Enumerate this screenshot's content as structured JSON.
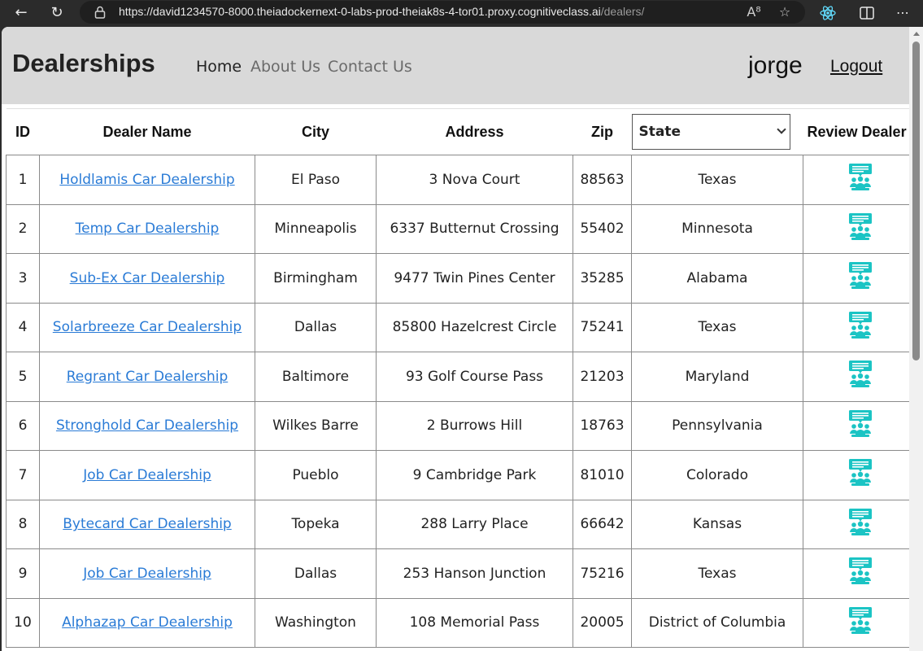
{
  "browser": {
    "url_host": "https://david1234570-8000.theiadockernext-0-labs-prod-theiak8s-4-tor01.proxy.cognitiveclass.ai",
    "url_path": "/dealers/"
  },
  "header": {
    "brand": "Dealerships",
    "nav": [
      {
        "label": "Home",
        "active": true
      },
      {
        "label": "About Us",
        "active": false
      },
      {
        "label": "Contact Us",
        "active": false
      }
    ],
    "username": "jorge",
    "logout": "Logout"
  },
  "table": {
    "columns": {
      "id": "ID",
      "name": "Dealer Name",
      "city": "City",
      "address": "Address",
      "zip": "Zip",
      "review": "Review Dealer"
    },
    "state_filter": {
      "selected": "State"
    },
    "rows": [
      {
        "id": "1",
        "name": "Holdlamis Car Dealership",
        "city": "El Paso",
        "address": "3 Nova Court",
        "zip": "88563",
        "state": "Texas"
      },
      {
        "id": "2",
        "name": "Temp Car Dealership",
        "city": "Minneapolis",
        "address": "6337 Butternut Crossing",
        "zip": "55402",
        "state": "Minnesota"
      },
      {
        "id": "3",
        "name": "Sub-Ex Car Dealership",
        "city": "Birmingham",
        "address": "9477 Twin Pines Center",
        "zip": "35285",
        "state": "Alabama"
      },
      {
        "id": "4",
        "name": "Solarbreeze Car Dealership",
        "city": "Dallas",
        "address": "85800 Hazelcrest Circle",
        "zip": "75241",
        "state": "Texas"
      },
      {
        "id": "5",
        "name": "Regrant Car Dealership",
        "city": "Baltimore",
        "address": "93 Golf Course Pass",
        "zip": "21203",
        "state": "Maryland"
      },
      {
        "id": "6",
        "name": "Stronghold Car Dealership",
        "city": "Wilkes Barre",
        "address": "2 Burrows Hill",
        "zip": "18763",
        "state": "Pennsylvania"
      },
      {
        "id": "7",
        "name": "Job Car Dealership",
        "city": "Pueblo",
        "address": "9 Cambridge Park",
        "zip": "81010",
        "state": "Colorado"
      },
      {
        "id": "8",
        "name": "Bytecard Car Dealership",
        "city": "Topeka",
        "address": "288 Larry Place",
        "zip": "66642",
        "state": "Kansas"
      },
      {
        "id": "9",
        "name": "Job Car Dealership",
        "city": "Dallas",
        "address": "253 Hanson Junction",
        "zip": "75216",
        "state": "Texas"
      },
      {
        "id": "10",
        "name": "Alphazap Car Dealership",
        "city": "Washington",
        "address": "108 Memorial Pass",
        "zip": "20005",
        "state": "District of Columbia"
      }
    ]
  },
  "colors": {
    "header_bg": "#d9d9d9",
    "link": "#2a7bd6",
    "review_icon": "#1bc4c4"
  }
}
